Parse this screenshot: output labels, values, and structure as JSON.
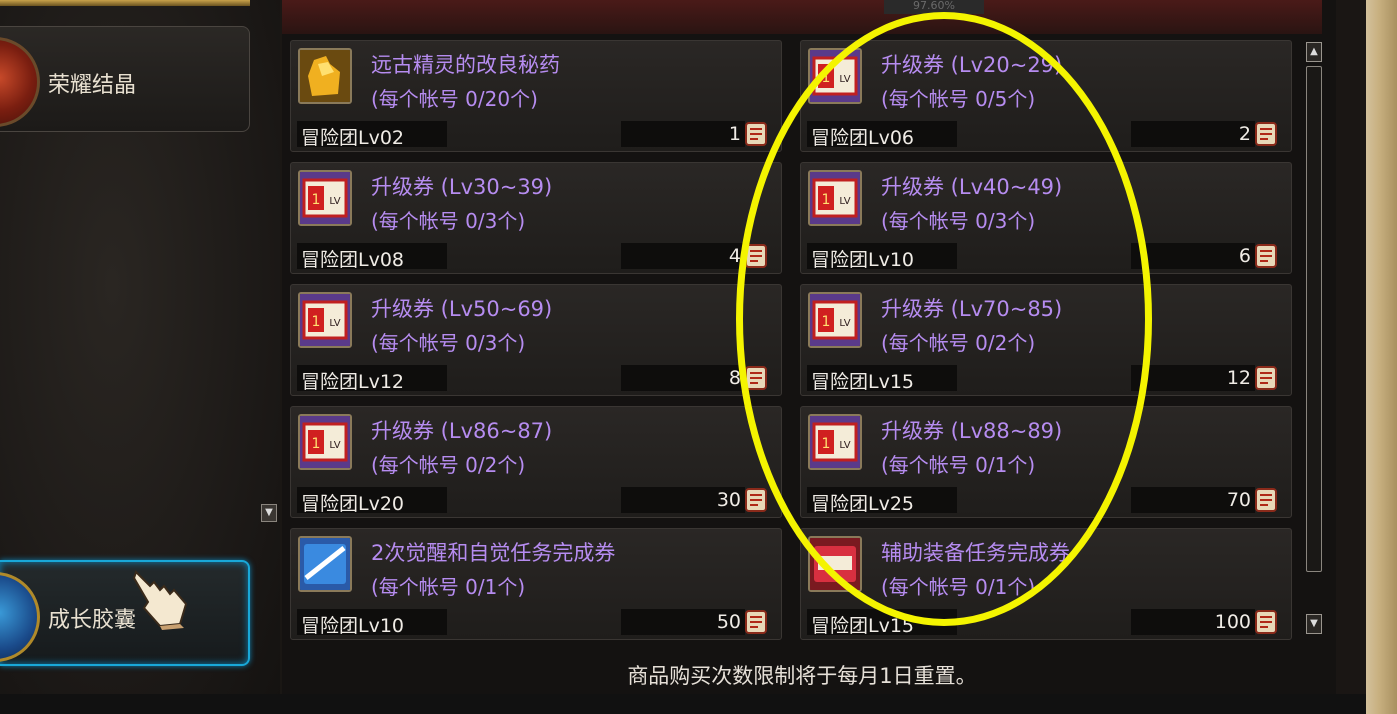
{
  "header": {
    "progress_text": "97.60%"
  },
  "sidebar": {
    "items": [
      {
        "label": "荣耀结晶"
      },
      {
        "label": "成长胶囊"
      }
    ]
  },
  "shop": {
    "items": [
      {
        "name": "远古精灵的改良秘药",
        "limit": "(每个帐号 0/20个)",
        "requirement": "冒险团Lv02",
        "price": "1",
        "icon": "golden-potion-icon"
      },
      {
        "name": "升级券 (Lv20~29)",
        "limit": "(每个帐号 0/5个)",
        "requirement": "冒险团Lv06",
        "price": "2",
        "icon": "level-up-ticket-icon"
      },
      {
        "name": "升级券 (Lv30~39)",
        "limit": "(每个帐号 0/3个)",
        "requirement": "冒险团Lv08",
        "price": "4",
        "icon": "level-up-ticket-icon"
      },
      {
        "name": "升级券 (Lv40~49)",
        "limit": "(每个帐号 0/3个)",
        "requirement": "冒险团Lv10",
        "price": "6",
        "icon": "level-up-ticket-icon"
      },
      {
        "name": "升级券 (Lv50~69)",
        "limit": "(每个帐号 0/3个)",
        "requirement": "冒险团Lv12",
        "price": "8",
        "icon": "level-up-ticket-icon"
      },
      {
        "name": "升级券 (Lv70~85)",
        "limit": "(每个帐号 0/2个)",
        "requirement": "冒险团Lv15",
        "price": "12",
        "icon": "level-up-ticket-icon"
      },
      {
        "name": "升级券 (Lv86~87)",
        "limit": "(每个帐号 0/2个)",
        "requirement": "冒险团Lv20",
        "price": "30",
        "icon": "level-up-ticket-icon"
      },
      {
        "name": "升级券 (Lv88~89)",
        "limit": "(每个帐号 0/1个)",
        "requirement": "冒险团Lv25",
        "price": "70",
        "icon": "level-up-ticket-icon"
      },
      {
        "name": "2次觉醒和自觉任务完成券",
        "limit": "(每个帐号 0/1个)",
        "requirement": "冒险团Lv10",
        "price": "50",
        "icon": "awakening-clear-ticket-icon"
      },
      {
        "name": "辅助装备任务完成券",
        "limit": "(每个帐号 0/1个)",
        "requirement": "冒险团Lv15",
        "price": "100",
        "icon": "quest-clear-ticket-icon"
      }
    ]
  },
  "footer": {
    "note": "商品购买次数限制将于每月1日重置。"
  },
  "colors": {
    "item_name": "#b68cf0",
    "highlight": "#f4f400",
    "active_border": "#19a8d8"
  }
}
